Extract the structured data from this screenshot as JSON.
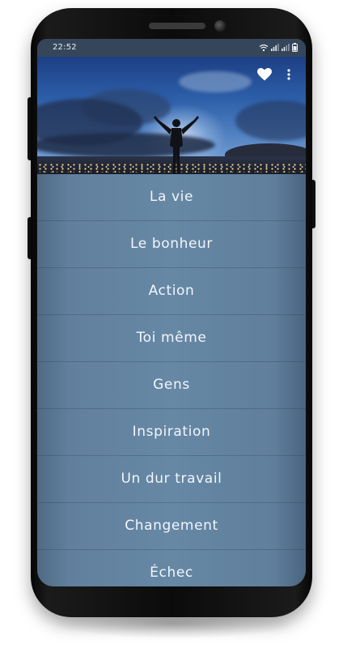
{
  "status_bar": {
    "time": "22:52",
    "icons": [
      "wifi-icon",
      "signal-icon",
      "signal-icon",
      "battery-icon"
    ]
  },
  "header": {
    "favorite_icon": "heart-icon",
    "more_icon": "more-vertical-icon"
  },
  "menu": {
    "items": [
      {
        "label": "La vie"
      },
      {
        "label": "Le bonheur"
      },
      {
        "label": "Action"
      },
      {
        "label": "Toi même"
      },
      {
        "label": "Gens"
      },
      {
        "label": "Inspiration"
      },
      {
        "label": "Un dur travail"
      },
      {
        "label": "Changement"
      },
      {
        "label": "Échec"
      }
    ]
  },
  "colors": {
    "list_background": "#6688a5",
    "status_bar": "#36465a",
    "text": "#f2f6fa"
  }
}
